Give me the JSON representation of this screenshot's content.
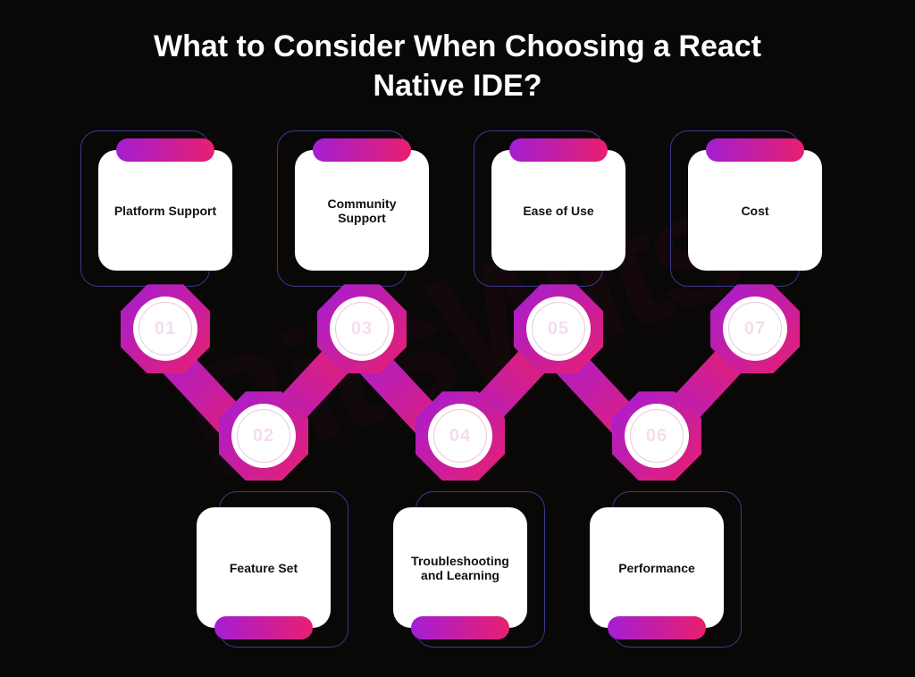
{
  "title": "What to Consider When Choosing a React Native IDE?",
  "watermark": "BitsWits",
  "cards": {
    "c1": "Platform Support",
    "c2": "Community Support",
    "c3": "Ease of Use",
    "c4": "Cost",
    "c5": "Feature Set",
    "c6": "Troubleshooting and Learning",
    "c7": "Performance"
  },
  "numbers": {
    "n1": "01",
    "n2": "02",
    "n3": "03",
    "n4": "04",
    "n5": "05",
    "n6": "06",
    "n7": "07"
  }
}
